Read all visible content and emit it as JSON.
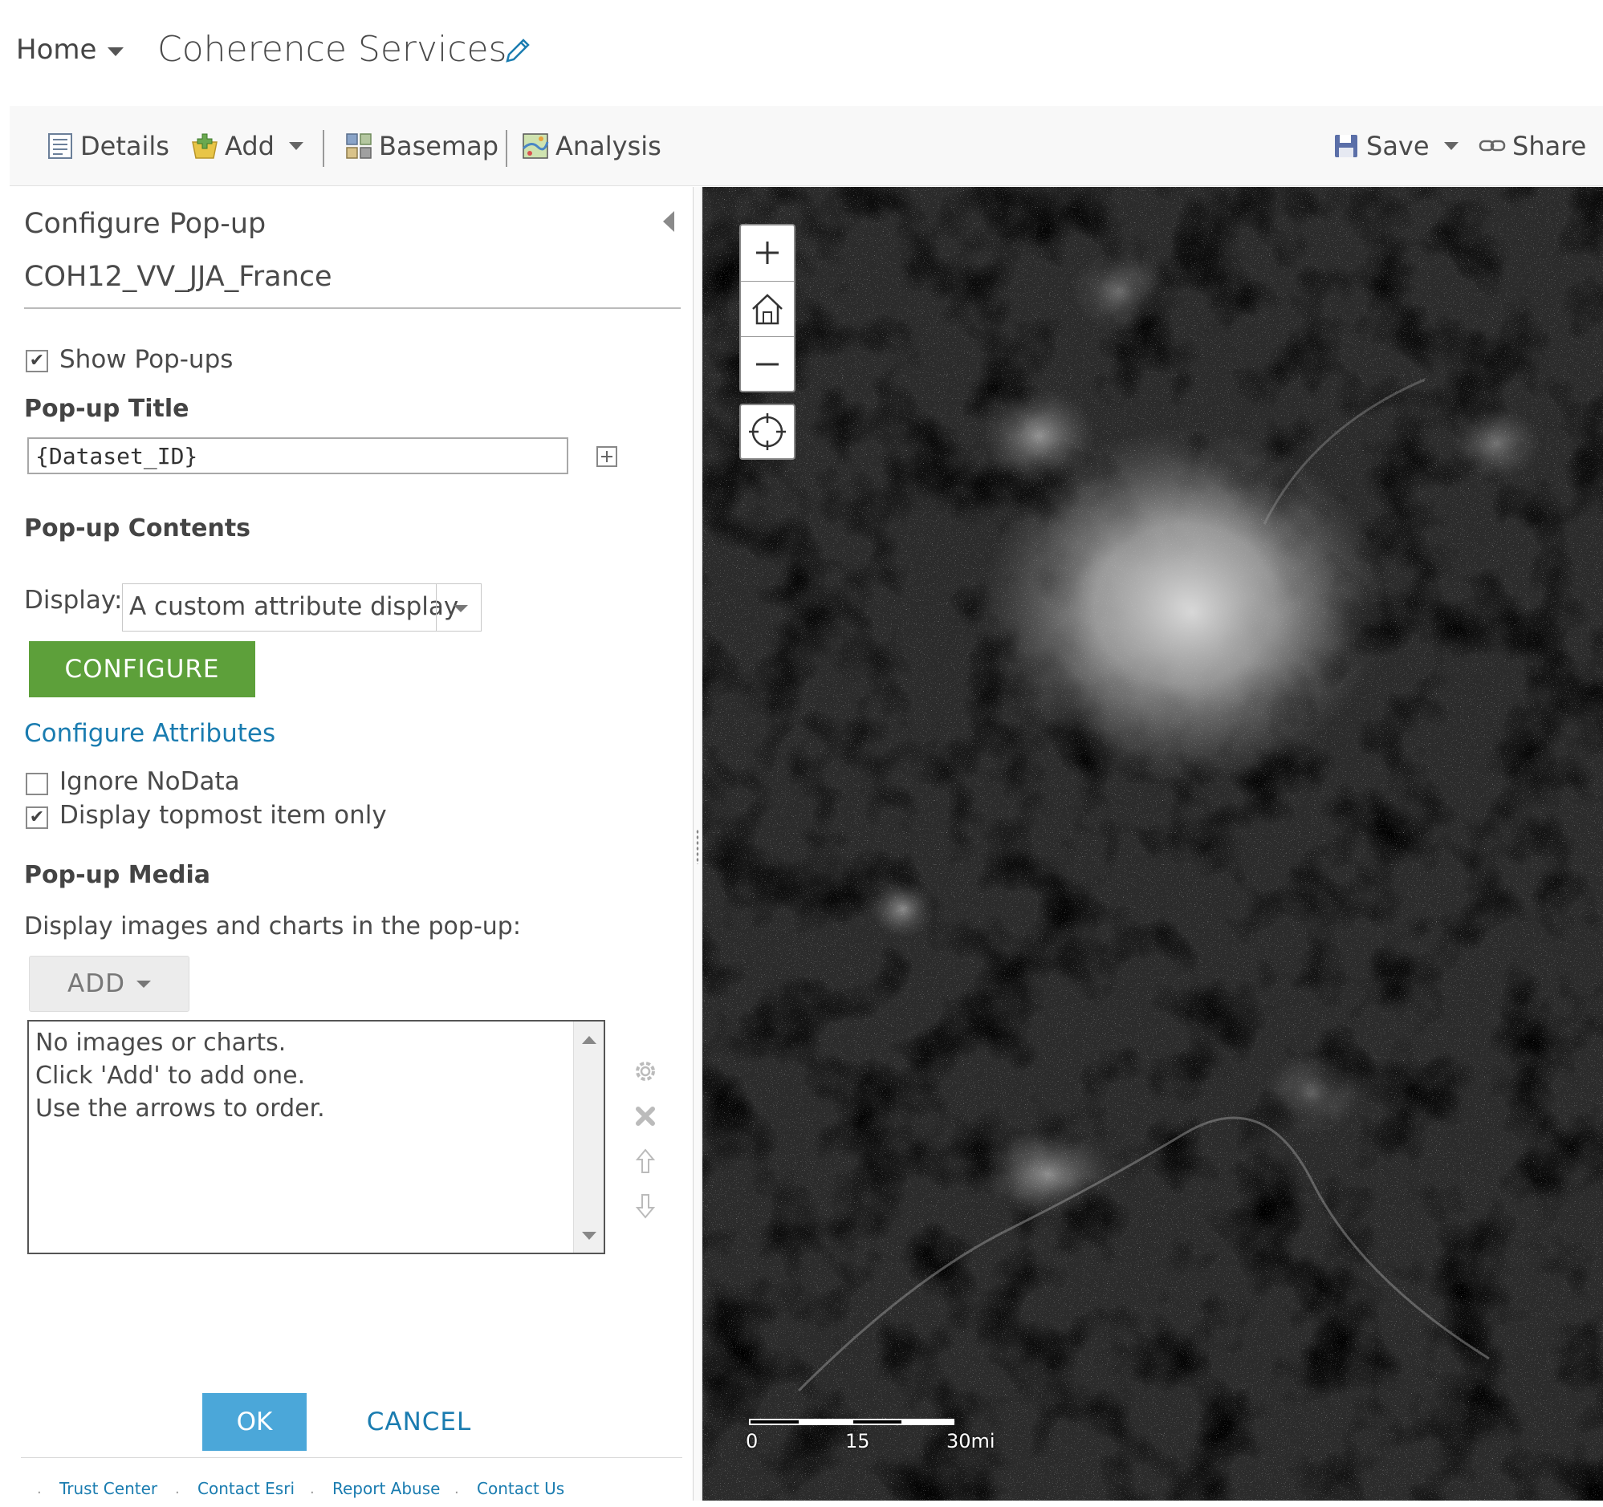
{
  "header": {
    "home_label": "Home",
    "app_title": "Coherence Services"
  },
  "toolbar": {
    "details_label": "Details",
    "add_label": "Add",
    "basemap_label": "Basemap",
    "analysis_label": "Analysis",
    "save_label": "Save",
    "share_label": "Share"
  },
  "panel": {
    "title": "Configure Pop-up",
    "layer_name": "COH12_VV_JJA_France",
    "show_popups_label": "Show Pop-ups",
    "show_popups_checked": true,
    "popup_title_heading": "Pop-up Title",
    "popup_title_value": "{Dataset_ID}",
    "popup_contents_heading": "Pop-up Contents",
    "display_label": "Display:",
    "display_value": "A custom attribute display",
    "configure_button": "CONFIGURE",
    "configure_attributes_link": "Configure Attributes",
    "ignore_nodata_label": "Ignore NoData",
    "ignore_nodata_checked": false,
    "topmost_label": "Display topmost item only",
    "topmost_checked": true,
    "popup_media_heading": "Pop-up Media",
    "media_description": "Display images and charts in the pop-up:",
    "add_media_button": "ADD",
    "media_list_lines": [
      "No images or charts.",
      "Click 'Add' to add one.",
      "Use the arrows to order."
    ],
    "ok_button": "OK",
    "cancel_button": "CANCEL"
  },
  "footer": {
    "links": [
      "Trust Center",
      "Contact Esri",
      "Report Abuse",
      "Contact Us"
    ]
  },
  "map": {
    "scale_labels": [
      "0",
      "15",
      "30mi"
    ]
  },
  "colors": {
    "accent_green": "#5da03a",
    "accent_blue": "#4ba7d9",
    "link_blue": "#1a7cb0"
  }
}
